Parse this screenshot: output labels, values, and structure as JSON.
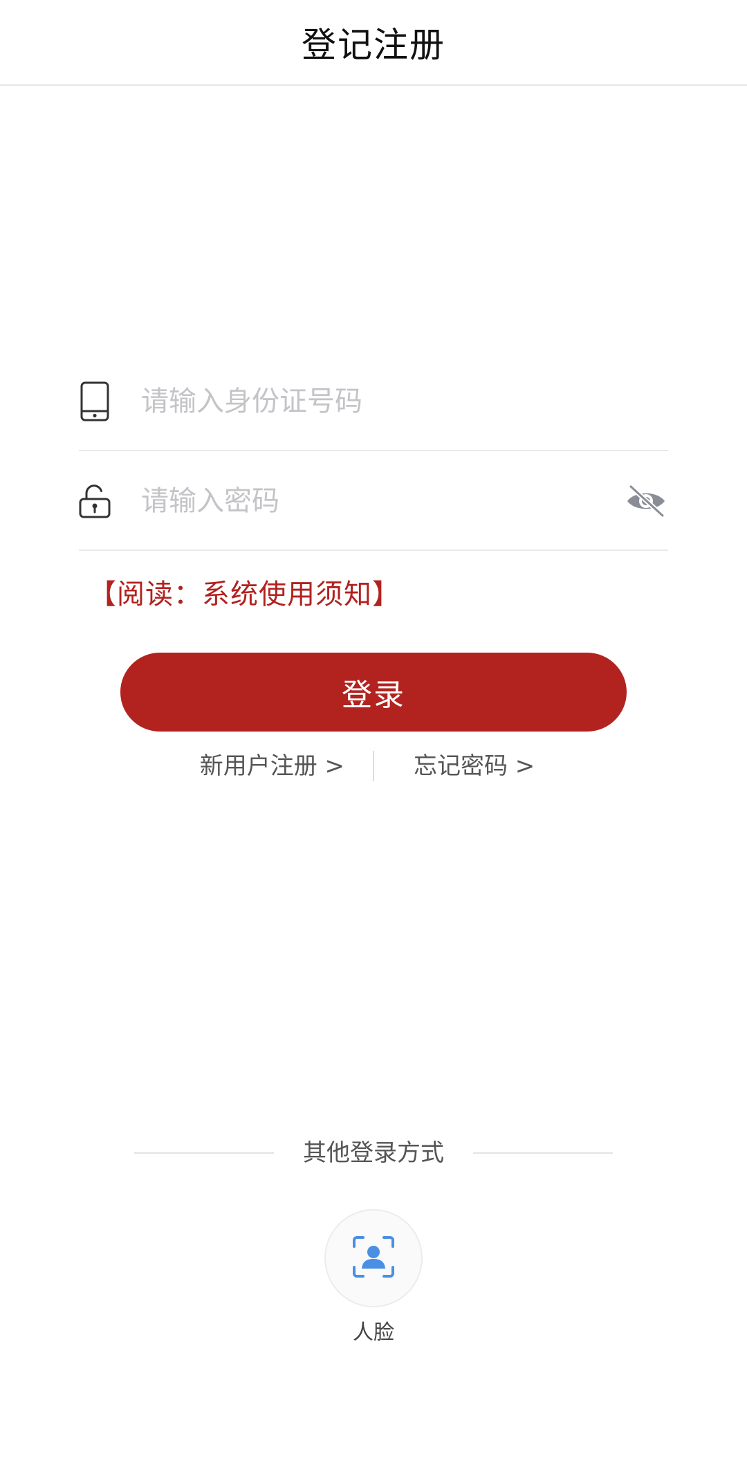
{
  "header": {
    "title": "登记注册"
  },
  "form": {
    "id_field": {
      "placeholder": "请输入身份证号码",
      "value": "",
      "icon": "phone-icon"
    },
    "password_field": {
      "placeholder": "请输入密码",
      "value": "",
      "icon": "unlock-icon",
      "toggle_icon": "eye-slash-icon"
    },
    "notice_link": "【阅读：系统使用须知】",
    "login_button": "登录",
    "register_link": "新用户注册 >",
    "forgot_link": "忘记密码 >"
  },
  "other_login": {
    "title": "其他登录方式",
    "methods": [
      {
        "label": "人脸",
        "icon": "face-scan-icon"
      }
    ]
  },
  "colors": {
    "brand_red": "#b2231f",
    "placeholder_gray": "#c4c4c8",
    "face_icon_blue": "#4a8fe3"
  }
}
